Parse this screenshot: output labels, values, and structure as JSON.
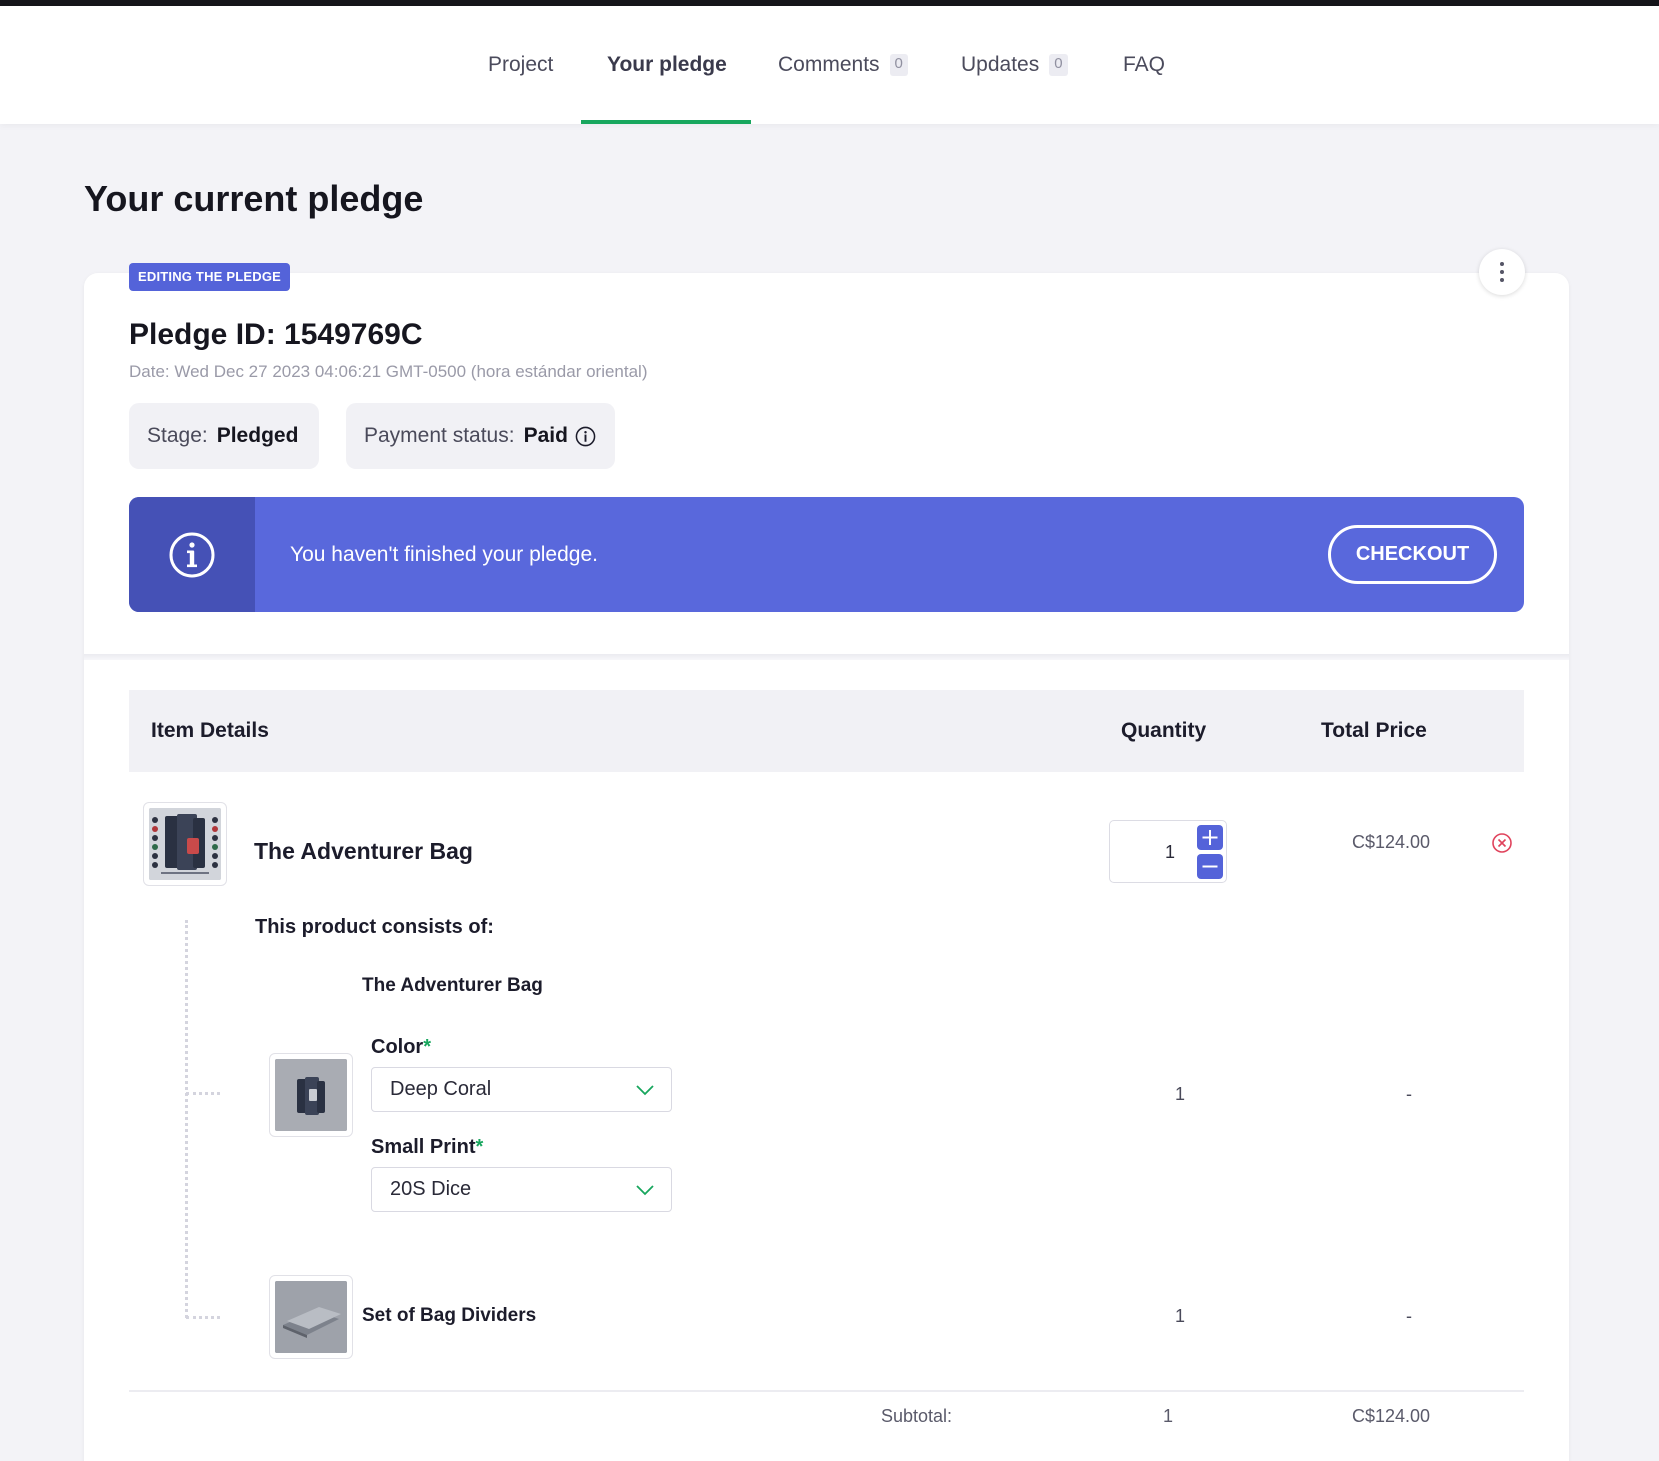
{
  "nav": {
    "tabs": [
      {
        "label": "Project"
      },
      {
        "label": "Your pledge",
        "active": true
      },
      {
        "label": "Comments",
        "count": "0"
      },
      {
        "label": "Updates",
        "count": "0"
      },
      {
        "label": "FAQ"
      }
    ]
  },
  "page": {
    "title": "Your current pledge"
  },
  "pledge": {
    "badge": "EDITING THE PLEDGE",
    "id_label": "Pledge ID: 1549769C",
    "date": "Date: Wed Dec 27 2023 04:06:21 GMT-0500 (hora estándar oriental)",
    "stage_label": "Stage:",
    "stage_value": "Pledged",
    "payment_label": "Payment status:",
    "payment_value": "Paid"
  },
  "alert": {
    "message": "You haven't finished your pledge.",
    "button": "CHECKOUT"
  },
  "table": {
    "headers": {
      "item": "Item Details",
      "quantity": "Quantity",
      "total": "Total Price"
    },
    "item": {
      "name": "The Adventurer Bag",
      "quantity": "1",
      "price": "C$124.00",
      "consists_label": "This product consists of:",
      "components": [
        {
          "name": "The Adventurer Bag",
          "quantity": "1",
          "price": "-",
          "options": [
            {
              "label": "Color",
              "required_mark": "*",
              "value": "Deep Coral"
            },
            {
              "label": "Small Print",
              "required_mark": "*",
              "value": "20S Dice"
            }
          ]
        },
        {
          "name": "Set of Bag Dividers",
          "quantity": "1",
          "price": "-"
        }
      ]
    },
    "subtotal": {
      "label": "Subtotal:",
      "quantity": "1",
      "price": "C$124.00"
    }
  },
  "colors": {
    "accent": "#5463d9",
    "alert_bg": "#5968dc",
    "alert_icon_bg": "#4551b6",
    "active_underline": "#17a65d",
    "remove": "#e0435c"
  },
  "icons": [
    "kebab-menu-icon",
    "info-icon",
    "plus-icon",
    "minus-icon",
    "remove-circle-icon",
    "chevron-down-icon"
  ]
}
